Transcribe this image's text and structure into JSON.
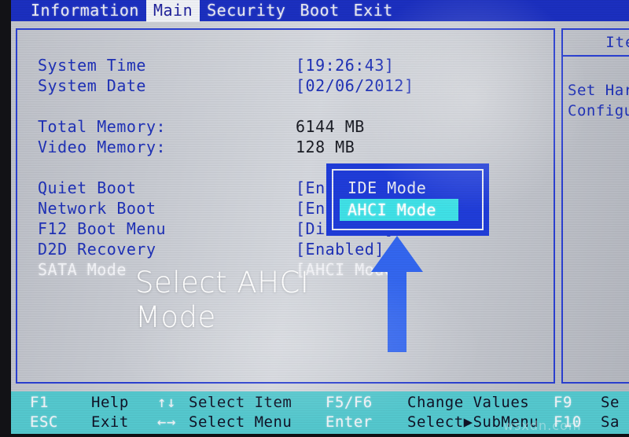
{
  "menubar": {
    "tabs": [
      {
        "label": "Information",
        "active": false
      },
      {
        "label": "Main",
        "active": true
      },
      {
        "label": "Security",
        "active": false
      },
      {
        "label": "Boot",
        "active": false
      },
      {
        "label": "Exit",
        "active": false
      }
    ]
  },
  "main_panel": {
    "rows": [
      {
        "label": "System Time",
        "value": "[19:26:43]",
        "style": "blue",
        "selected": false
      },
      {
        "label": "System Date",
        "value": "[02/06/2012]",
        "style": "blue",
        "selected": false
      },
      {
        "label": "Total Memory:",
        "value": "6144 MB",
        "style": "plainval",
        "selected": false
      },
      {
        "label": "Video Memory:",
        "value": "128 MB",
        "style": "plainval",
        "selected": false
      },
      {
        "label": "Quiet Boot",
        "value": "[Enabled]",
        "style": "blue",
        "selected": false
      },
      {
        "label": "Network Boot",
        "value": "[Enabled]",
        "style": "blue",
        "selected": false
      },
      {
        "label": "F12 Boot Menu",
        "value": "[Disabled]",
        "style": "blue",
        "selected": false
      },
      {
        "label": "D2D Recovery",
        "value": "[Enabled]",
        "style": "blue",
        "selected": false
      },
      {
        "label": "SATA Mode",
        "value": "[AHCI Mode]",
        "style": "blue",
        "selected": true
      }
    ]
  },
  "popup": {
    "options": [
      {
        "label": "IDE Mode",
        "highlighted": false
      },
      {
        "label": "AHCI Mode",
        "highlighted": true
      }
    ]
  },
  "side_panel": {
    "title": "Item",
    "lines": [
      "Set Hard",
      "Configur"
    ]
  },
  "annotation": {
    "text_line1": "Select AHCI",
    "text_line2": "Mode",
    "arrow_color": "#3366ee"
  },
  "statusbar": {
    "columns": [
      {
        "class": "col-a",
        "lines": [
          {
            "key": "F1",
            "desc": "Help"
          },
          {
            "key": "ESC",
            "desc": "Exit"
          }
        ]
      },
      {
        "class": "col-b",
        "lines": [
          {
            "key": "↑↓",
            "desc": "Select Item"
          },
          {
            "key": "←→",
            "desc": "Select Menu"
          }
        ]
      },
      {
        "class": "col-c",
        "lines": [
          {
            "key": "F5/F6",
            "desc": "Change Values"
          },
          {
            "key": "Enter",
            "desc": "Select▶SubMenu"
          }
        ]
      },
      {
        "class": "col-d",
        "lines": [
          {
            "key": "F9",
            "desc": "Se"
          },
          {
            "key": "F10",
            "desc": "Sa"
          }
        ]
      }
    ]
  },
  "watermark": {
    "text": "wsxdn.com"
  },
  "colors": {
    "menubar_blue": "#1b2fbf",
    "text_blue": "#1f31b6",
    "popup_blue": "#1f3cd8",
    "highlight_cyan": "#3fe0e6",
    "statusbar_cyan": "#54c7cd",
    "arrow_blue": "#3366ee"
  }
}
